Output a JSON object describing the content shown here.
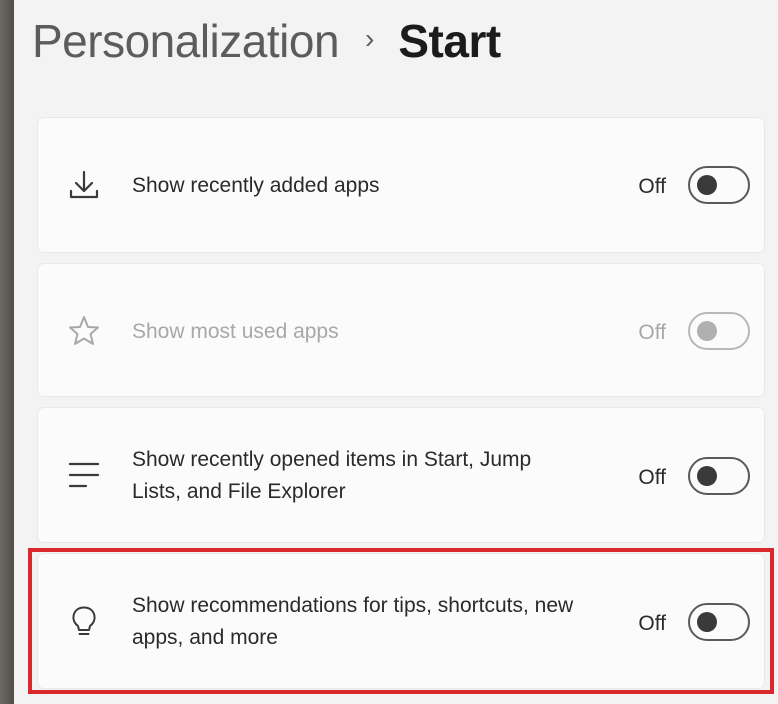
{
  "breadcrumb": {
    "parent": "Personalization",
    "separator": "›",
    "current": "Start"
  },
  "settings": [
    {
      "icon": "download-icon",
      "label": "Show recently added apps",
      "state": "Off",
      "toggle_on": false,
      "disabled": false
    },
    {
      "icon": "star-icon",
      "label": "Show most used apps",
      "state": "Off",
      "toggle_on": false,
      "disabled": true
    },
    {
      "icon": "list-icon",
      "label": "Show recently opened items in Start, Jump Lists, and File Explorer",
      "state": "Off",
      "toggle_on": false,
      "disabled": false
    },
    {
      "icon": "lightbulb-icon",
      "label": "Show recommendations for tips, shortcuts, new apps, and more",
      "state": "Off",
      "toggle_on": false,
      "disabled": false
    }
  ],
  "colors": {
    "highlight_border": "#d9272b",
    "background": "#f3f3f3",
    "card": "#fbfbfb"
  }
}
